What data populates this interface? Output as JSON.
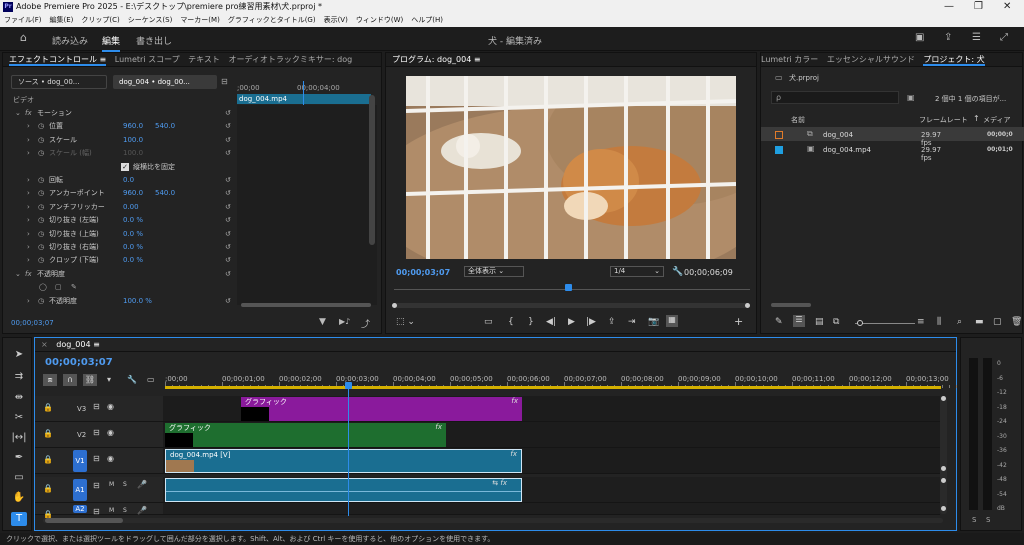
{
  "window": {
    "title": "Adobe Premiere Pro 2025 - E:\\デスクトップ\\premiere pro練習用素材\\犬.prproj *",
    "app_logo": "Pr"
  },
  "menu": [
    "ファイル(F)",
    "編集(E)",
    "クリップ(C)",
    "シーケンス(S)",
    "マーカー(M)",
    "グラフィックとタイトル(G)",
    "表示(V)",
    "ウィンドウ(W)",
    "ヘルプ(H)"
  ],
  "workspace": {
    "tabs": [
      "読み込み",
      "編集",
      "書き出し"
    ],
    "active": "編集",
    "title": "犬 - 編集済み"
  },
  "effect_controls": {
    "tabs": [
      "エフェクトコントロール ≡",
      "Lumetri スコープ",
      "テキスト",
      "オーディオトラックミキサー: dog"
    ],
    "source_label": "ソース • dog_00...",
    "sequence_label": "dog_004 • dog_00...",
    "ruler_start": ";00;00",
    "ruler_mid": "00;00;04;00",
    "clip_name": "dog_004.mp4",
    "section_video": "ビデオ",
    "rows": [
      {
        "label": "モーション",
        "fx": true
      },
      {
        "label": "位置",
        "v1": "960.0",
        "v2": "540.0"
      },
      {
        "label": "スケール",
        "v1": "100.0"
      },
      {
        "label": "スケール (幅)",
        "v1": "100.0",
        "disabled": true
      },
      {
        "label": "縦横比を固定",
        "checkbox": true
      },
      {
        "label": "回転",
        "v1": "0.0"
      },
      {
        "label": "アンカーポイント",
        "v1": "960.0",
        "v2": "540.0"
      },
      {
        "label": "アンチフリッカー",
        "v1": "0.00"
      },
      {
        "label": "切り抜き (左端)",
        "v1": "0.0 %"
      },
      {
        "label": "切り抜き (上端)",
        "v1": "0.0 %"
      },
      {
        "label": "切り抜き (右端)",
        "v1": "0.0 %"
      },
      {
        "label": "クロップ (下端)",
        "v1": "0.0 %"
      },
      {
        "label": "不透明度",
        "fx": true
      },
      {
        "label": "",
        "shapes": true
      },
      {
        "label": "不透明度",
        "v1": "100.0 %"
      }
    ],
    "timecode": "00;00;03;07"
  },
  "program": {
    "tab": "プログラム: dog_004 ≡",
    "timecode": "00;00;03;07",
    "zoom": "全体表示",
    "resolution": "1/4",
    "duration": "00;00;06;09",
    "playhead_fraction": 0.48
  },
  "project": {
    "tabs": [
      "Lumetri カラー",
      "エッセンシャルサウンド",
      "プロジェクト: 犬"
    ],
    "project_file": "犬.prproj",
    "search_placeholder": "ρ",
    "status": "2 個中 1 個の項目が...",
    "columns": {
      "name": "名前",
      "framerate": "フレームレート",
      "media": "メディア"
    },
    "items": [
      {
        "name": "dog_004",
        "fps": "29.97 fps",
        "time": "00;00;0",
        "color": "#e07b2a",
        "type": "sequence"
      },
      {
        "name": "dog_004.mp4",
        "fps": "29.97 fps",
        "time": "00;01;0",
        "color": "#1f9fe0",
        "type": "clip"
      }
    ]
  },
  "timeline": {
    "tab": "dog_004 ≡",
    "timecode": "00;00;03;07",
    "ruler": [
      ";00;00",
      "00;00;01;00",
      "00;00;02;00",
      "00;00;03;00",
      "00;00;04;00",
      "00;00;05;00",
      "00;00;06;00",
      "00;00;07;00",
      "00;00;08;00",
      "00;00;09;00",
      "00;00;10;00",
      "00;00;11;00",
      "00;00;12;00",
      "00;00;13;00"
    ],
    "tracks": [
      {
        "label": "V3"
      },
      {
        "label": "V2"
      },
      {
        "label": "V1",
        "target": "V1"
      },
      {
        "label": "A1",
        "target": "A1"
      },
      {
        "label": "",
        "target": "A2"
      }
    ],
    "clips": {
      "graphic_v3": "グラフィック",
      "graphic_v2": "グラフィック",
      "video": "dog_004.mp4 [V]",
      "fx": "fx"
    }
  },
  "audio_meter": {
    "scale": [
      "0",
      "-6",
      "-12",
      "-18",
      "-24",
      "-30",
      "-36",
      "-42",
      "-48",
      "-54",
      "dB"
    ],
    "solo": [
      "S",
      "S"
    ]
  },
  "status_bar": "クリックで選択、または選択ツールをドラッグして囲んだ部分を選択します。Shift、Alt、および Ctrl キーを使用すると、他のオプションを使用できます。",
  "colors": {
    "accent": "#2d8ceb",
    "graphic_v3": "#8a1a9c",
    "graphic_v2": "#1e6e2f",
    "video_clip": "#1a6e91",
    "audio_clip": "#1a6e91"
  }
}
